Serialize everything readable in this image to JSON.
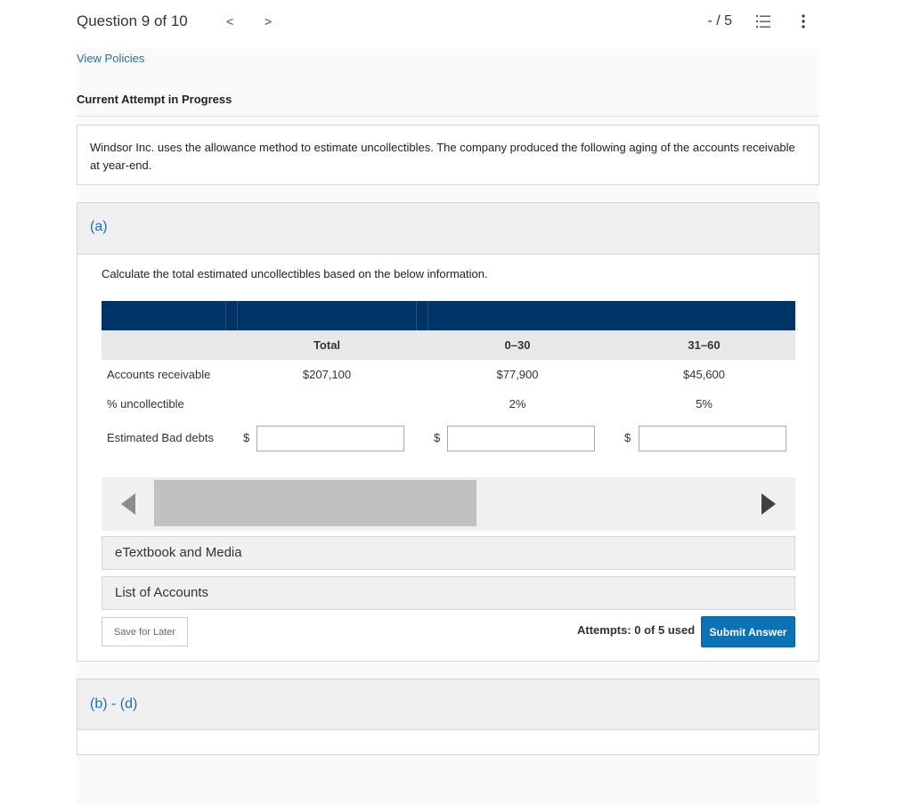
{
  "header": {
    "question_label": "Question 9 of 10",
    "prev_symbol": "<",
    "next_symbol": ">",
    "score": "- / 5"
  },
  "links": {
    "view_policies": "View Policies"
  },
  "status": {
    "attempt_title": "Current Attempt in Progress"
  },
  "intro": {
    "text": "Windsor Inc. uses the allowance method to estimate uncollectibles. The company produced the following aging of the accounts receivable at year-end."
  },
  "part_a": {
    "label": "(a)",
    "instruction": "Calculate the total estimated uncollectibles based on the below information.",
    "table": {
      "columns": [
        "",
        "Total",
        "0–30",
        "31–60"
      ],
      "rows": [
        {
          "label": "Accounts receivable",
          "cells": [
            "$207,100",
            "$77,900",
            "$45,600"
          ]
        },
        {
          "label": "% uncollectible",
          "cells": [
            "",
            "2%",
            "5%"
          ]
        }
      ],
      "bad_debts_label": "Estimated Bad debts",
      "currency_symbol": "$",
      "inputs": [
        "",
        "",
        ""
      ]
    },
    "resources": [
      "eTextbook and Media",
      "List of Accounts"
    ],
    "save_label": "Save for Later",
    "attempts": "Attempts: 0 of 5 used",
    "submit_label": "Submit Answer"
  },
  "part_bd": {
    "label": "(b) - (d)"
  },
  "icons": {
    "list": "numbered-list-icon",
    "more": "vertical-ellipsis-icon",
    "scroll_left": "triangle-left-icon",
    "scroll_right": "triangle-right-icon"
  },
  "colors": {
    "accent": "#1e6fb5",
    "table_header": "#003366",
    "submit": "#0b72b5"
  }
}
